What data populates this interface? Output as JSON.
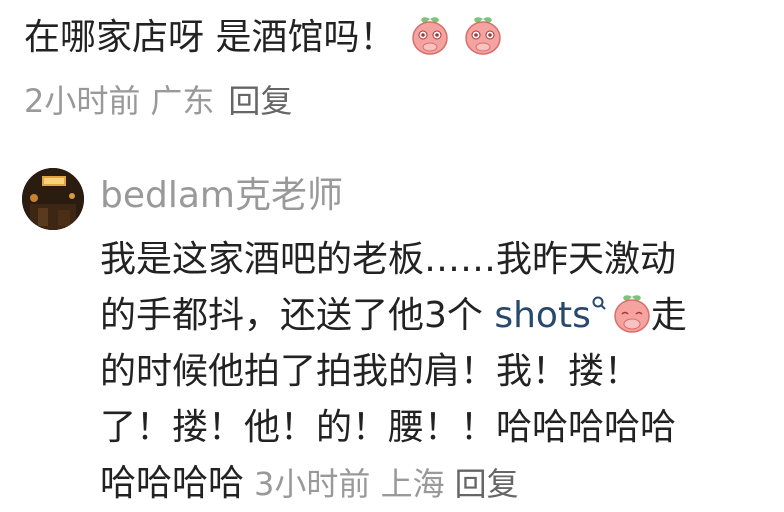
{
  "top_comment": {
    "text": "在哪家店呀 是酒馆吗！",
    "time": "2小时前",
    "location": "广东",
    "reply_label": "回复"
  },
  "reply_comment": {
    "username": "bedlam克老师",
    "line1": "我是这家酒吧的老板……我昨天激动",
    "line2_before": "的手都抖，还送了他3个 ",
    "link_text": "shots",
    "line2_after": "走",
    "line3": "的时候他拍了拍我的肩！我！搂！",
    "line4": "了！搂！他！的！腰！！哈哈哈哈哈",
    "line5": "哈哈哈哈",
    "time": "3小时前",
    "location": "上海",
    "reply_label": "回复"
  },
  "icons": {
    "emoji": "shy-peach-emoji",
    "search": "search-icon",
    "avatar": "bar-photo-avatar"
  },
  "colors": {
    "text": "#222222",
    "meta": "#999999",
    "link": "#27496d",
    "emoji_pink": "#f4a3a0"
  }
}
